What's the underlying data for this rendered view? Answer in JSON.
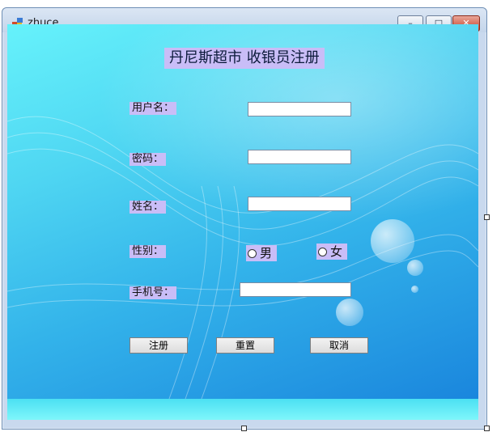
{
  "window": {
    "title": "zhuce",
    "minimize_glyph": "–",
    "maximize_glyph": "□",
    "close_glyph": "✕"
  },
  "form": {
    "heading": "丹尼斯超市 收银员注册",
    "username_label": "用户名：",
    "username_value": "",
    "password_label": "密码：",
    "password_value": "",
    "name_label": "姓名：",
    "name_value": "",
    "gender_label": "性别：",
    "gender_options": [
      "男",
      "女"
    ],
    "phone_label": "手机号：",
    "phone_value": ""
  },
  "buttons": {
    "register": "注册",
    "reset": "重置",
    "cancel": "取消"
  }
}
